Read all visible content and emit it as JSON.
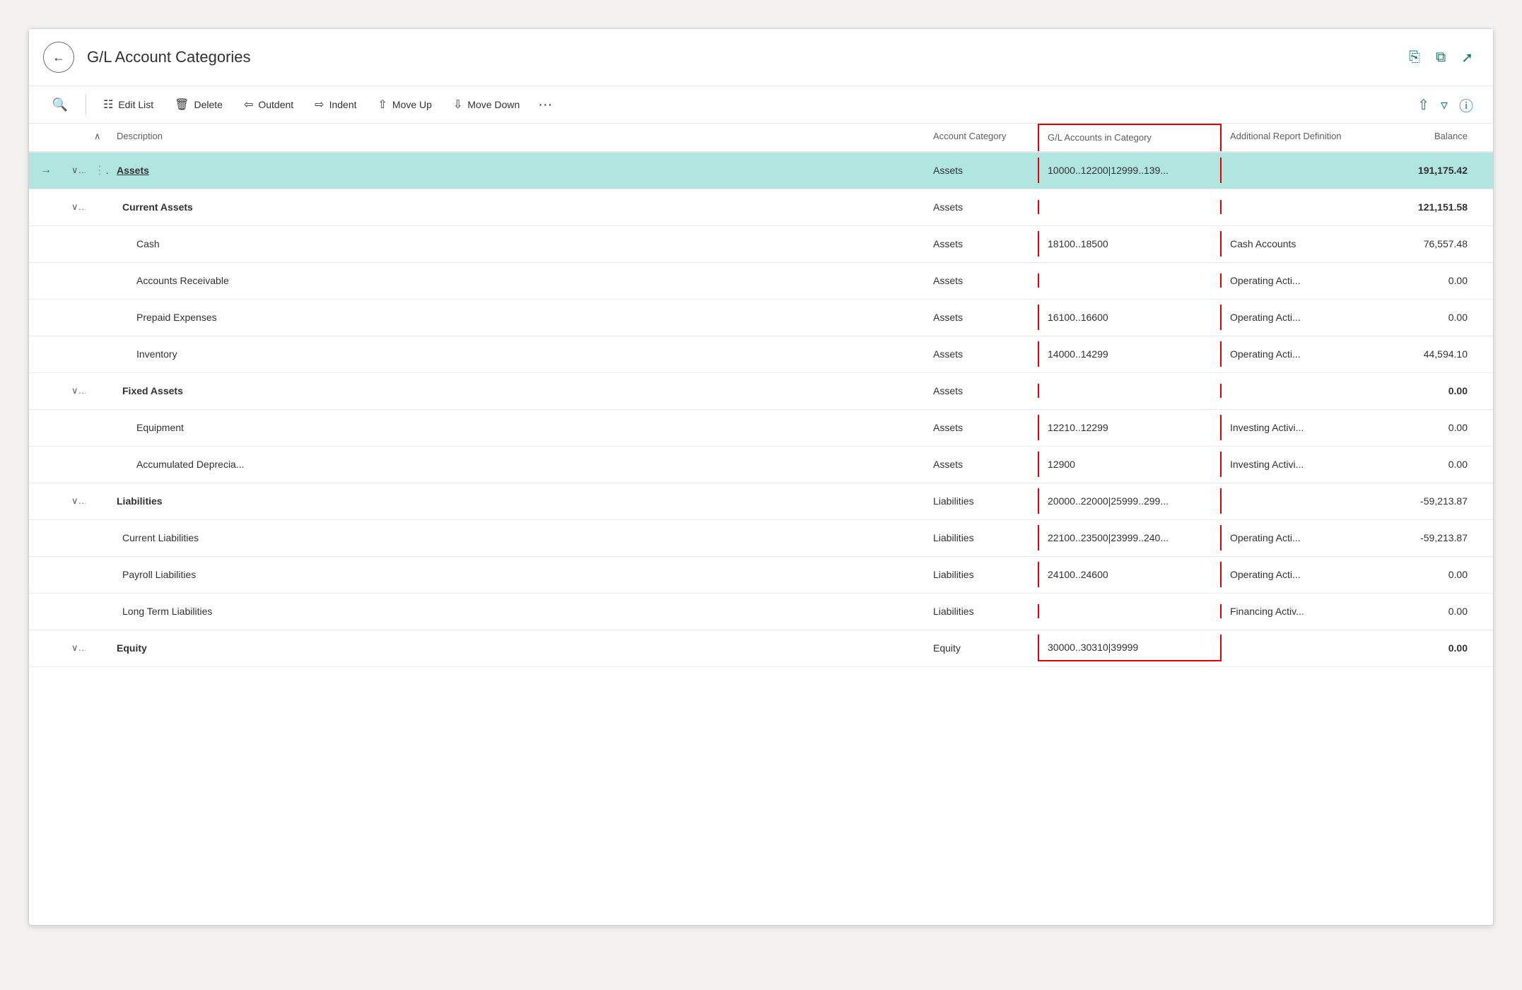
{
  "window": {
    "title": "G/L Account Categories"
  },
  "toolbar": {
    "search_icon": "🔍",
    "edit_list_label": "Edit List",
    "delete_label": "Delete",
    "outdent_label": "Outdent",
    "indent_label": "Indent",
    "move_up_label": "Move Up",
    "move_down_label": "Move Down",
    "more_icon": "···"
  },
  "table": {
    "columns": [
      {
        "id": "arrow",
        "label": ""
      },
      {
        "id": "chevron1",
        "label": ""
      },
      {
        "id": "sort",
        "label": ""
      },
      {
        "id": "description",
        "label": "Description"
      },
      {
        "id": "account_category",
        "label": "Account Category"
      },
      {
        "id": "gl_accounts",
        "label": "G/L Accounts in Category"
      },
      {
        "id": "additional_report",
        "label": "Additional Report Definition"
      },
      {
        "id": "balance",
        "label": "Balance",
        "align": "right"
      },
      {
        "id": "scroll",
        "label": ""
      }
    ],
    "rows": [
      {
        "id": 1,
        "arrow": "→",
        "chevron": "∨",
        "drag": "",
        "description": "Assets",
        "description_bold": true,
        "description_underline": true,
        "description_indent": 0,
        "account_category": "Assets",
        "gl_accounts": "10000..12200|12999..139...",
        "additional_report": "",
        "balance": "191,175.42",
        "balance_bold": true,
        "selected": true,
        "show_drag": true
      },
      {
        "id": 2,
        "arrow": "",
        "chevron": "∨",
        "drag": "",
        "description": "Current Assets",
        "description_bold": true,
        "description_indent": 1,
        "account_category": "Assets",
        "gl_accounts": "",
        "additional_report": "",
        "balance": "121,151.58",
        "balance_bold": true,
        "selected": false
      },
      {
        "id": 3,
        "arrow": "",
        "chevron": "",
        "drag": "",
        "description": "Cash",
        "description_bold": false,
        "description_indent": 2,
        "account_category": "Assets",
        "gl_accounts": "18100..18500",
        "additional_report": "Cash Accounts",
        "balance": "76,557.48",
        "balance_bold": false,
        "selected": false
      },
      {
        "id": 4,
        "arrow": "",
        "chevron": "",
        "drag": "",
        "description": "Accounts Receivable",
        "description_bold": false,
        "description_indent": 2,
        "account_category": "Assets",
        "gl_accounts": "",
        "additional_report": "Operating Acti...",
        "balance": "0.00",
        "balance_bold": false,
        "selected": false
      },
      {
        "id": 5,
        "arrow": "",
        "chevron": "",
        "drag": "",
        "description": "Prepaid Expenses",
        "description_bold": false,
        "description_indent": 2,
        "account_category": "Assets",
        "gl_accounts": "16100..16600",
        "additional_report": "Operating Acti...",
        "balance": "0.00",
        "balance_bold": false,
        "selected": false
      },
      {
        "id": 6,
        "arrow": "",
        "chevron": "",
        "drag": "",
        "description": "Inventory",
        "description_bold": false,
        "description_indent": 2,
        "account_category": "Assets",
        "gl_accounts": "14000..14299",
        "additional_report": "Operating Acti...",
        "balance": "44,594.10",
        "balance_bold": false,
        "selected": false
      },
      {
        "id": 7,
        "arrow": "",
        "chevron": "∨",
        "drag": "",
        "description": "Fixed Assets",
        "description_bold": true,
        "description_indent": 1,
        "account_category": "Assets",
        "gl_accounts": "",
        "additional_report": "",
        "balance": "0.00",
        "balance_bold": true,
        "selected": false
      },
      {
        "id": 8,
        "arrow": "",
        "chevron": "",
        "drag": "",
        "description": "Equipment",
        "description_bold": false,
        "description_indent": 2,
        "account_category": "Assets",
        "gl_accounts": "12210..12299",
        "additional_report": "Investing Activi...",
        "balance": "0.00",
        "balance_bold": false,
        "selected": false
      },
      {
        "id": 9,
        "arrow": "",
        "chevron": "",
        "drag": "",
        "description": "Accumulated Deprecia...",
        "description_bold": false,
        "description_indent": 2,
        "account_category": "Assets",
        "gl_accounts": "12900",
        "additional_report": "Investing Activi...",
        "balance": "0.00",
        "balance_bold": false,
        "selected": false
      },
      {
        "id": 10,
        "arrow": "",
        "chevron": "∨",
        "drag": "",
        "description": "Liabilities",
        "description_bold": true,
        "description_indent": 0,
        "account_category": "Liabilities",
        "gl_accounts": "20000..22000|25999..299...",
        "additional_report": "",
        "balance": "-59,213.87",
        "balance_bold": false,
        "selected": false
      },
      {
        "id": 11,
        "arrow": "",
        "chevron": "",
        "drag": "",
        "description": "Current Liabilities",
        "description_bold": false,
        "description_indent": 1,
        "account_category": "Liabilities",
        "gl_accounts": "22100..23500|23999..240...",
        "additional_report": "Operating Acti...",
        "balance": "-59,213.87",
        "balance_bold": false,
        "selected": false
      },
      {
        "id": 12,
        "arrow": "",
        "chevron": "",
        "drag": "",
        "description": "Payroll Liabilities",
        "description_bold": false,
        "description_indent": 1,
        "account_category": "Liabilities",
        "gl_accounts": "24100..24600",
        "additional_report": "Operating Acti...",
        "balance": "0.00",
        "balance_bold": false,
        "selected": false
      },
      {
        "id": 13,
        "arrow": "",
        "chevron": "",
        "drag": "",
        "description": "Long Term Liabilities",
        "description_bold": false,
        "description_indent": 1,
        "account_category": "Liabilities",
        "gl_accounts": "",
        "additional_report": "Financing Activ...",
        "balance": "0.00",
        "balance_bold": false,
        "selected": false
      },
      {
        "id": 14,
        "arrow": "",
        "chevron": "∨",
        "drag": "",
        "description": "Equity",
        "description_bold": true,
        "description_indent": 0,
        "account_category": "Equity",
        "gl_accounts": "30000..30310|39999",
        "additional_report": "",
        "balance": "0.00",
        "balance_bold": true,
        "selected": false
      }
    ]
  }
}
